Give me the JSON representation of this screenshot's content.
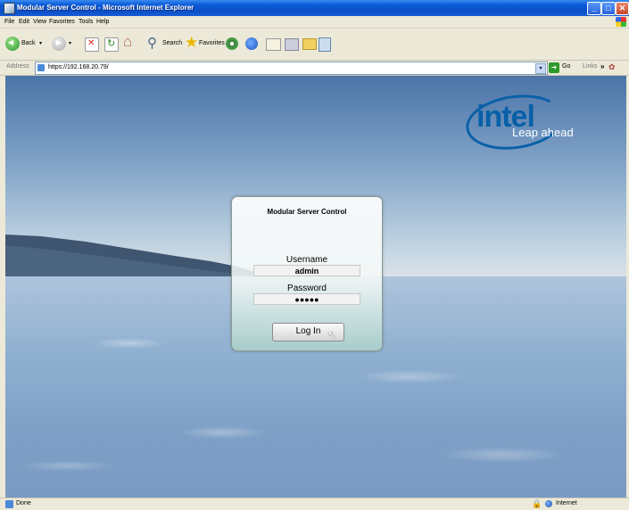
{
  "window": {
    "title": "Modular Server Control - Microsoft Internet Explorer",
    "buttons": {
      "minimize": "_",
      "maximize": "□",
      "close": "✕"
    }
  },
  "menu": [
    "File",
    "Edit",
    "View",
    "Favorites",
    "Tools",
    "Help"
  ],
  "toolbar": {
    "back_label": "Back",
    "search_label": "Search",
    "favorites_label": "Favorites",
    "dropdown": "▾"
  },
  "address_bar": {
    "label": "Address",
    "url": "https://192.168.20.79/",
    "go_label": "Go",
    "links_label": "Links",
    "links_chevron": "»"
  },
  "branding": {
    "logo_text": "intel",
    "tagline": "Leap ahead"
  },
  "login": {
    "title": "Modular Server Control",
    "username_label": "Username",
    "username_value": "admin",
    "password_label": "Password",
    "password_value": "●●●●●",
    "button_label": "Log In"
  },
  "status_bar": {
    "status": "Done",
    "zone": "Internet"
  },
  "colors": {
    "intel_blue": "#0860a8",
    "xp_title_blue": "#0a4fc6",
    "chrome_beige": "#ece9d8"
  },
  "icons": {
    "app": "ie-page-icon",
    "back": "back-arrow-icon",
    "forward": "forward-arrow-icon",
    "stop": "stop-icon",
    "refresh": "refresh-icon",
    "home": "home-icon",
    "search": "search-icon",
    "favorites": "star-icon",
    "media": "media-icon",
    "history": "history-icon",
    "mail": "mail-icon",
    "print": "print-icon",
    "lock": "lock-icon",
    "zone": "internet-zone-icon"
  }
}
